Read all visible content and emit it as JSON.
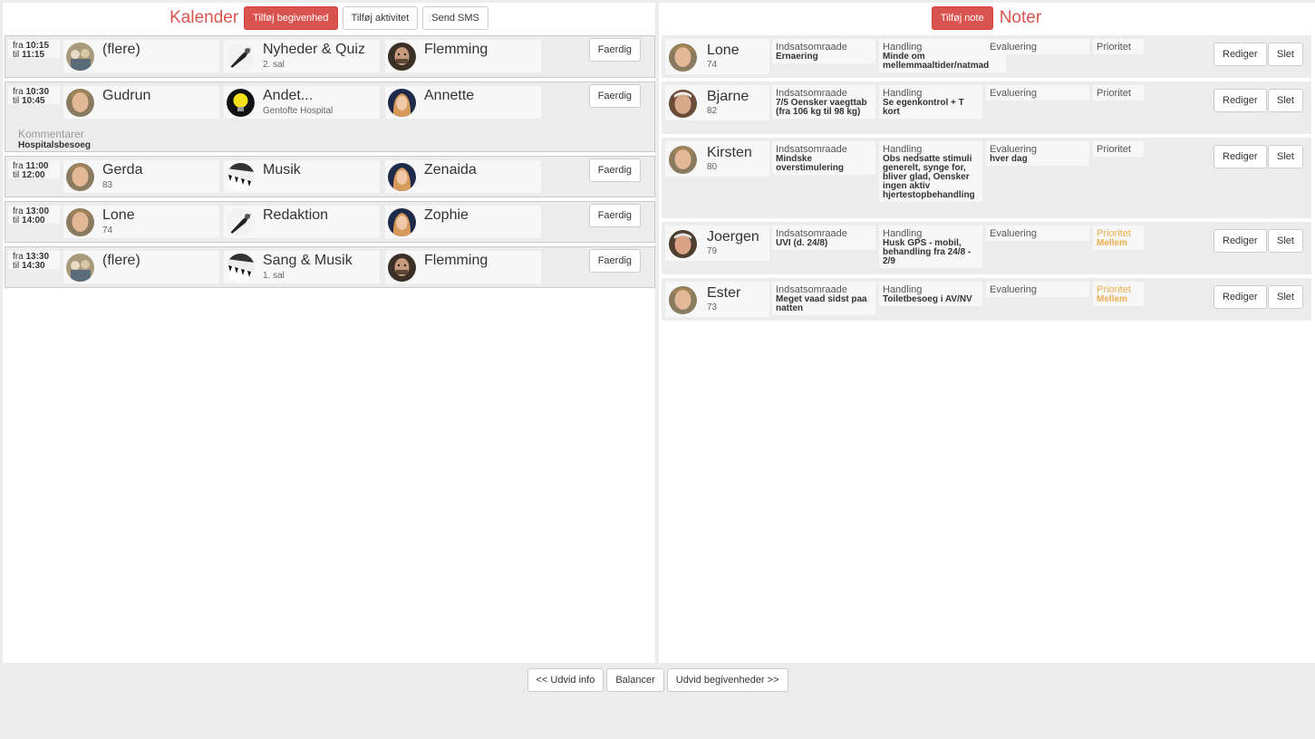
{
  "calendar": {
    "title": "Kalender",
    "buttons": {
      "add_event": "Tilføj begivenhed",
      "add_activity": "Tilføj aktivitet",
      "send_sms": "Send SMS"
    },
    "done_label": "Faerdig",
    "events": [
      {
        "from_prefix": "fra",
        "from": "10:15",
        "to_prefix": "til",
        "to": "11:15",
        "person": "(flere)",
        "person_sub": "",
        "activity": "Nyheder & Quiz",
        "activity_sub": "2. sal",
        "staff": "Flemming"
      },
      {
        "from_prefix": "fra",
        "from": "10:30",
        "to_prefix": "til",
        "to": "10:45",
        "person": "Gudrun",
        "person_sub": "",
        "activity": "Andet...",
        "activity_sub": "Gentofte Hospital",
        "staff": "Annette",
        "comment_label": "Kommentarer",
        "comment": "Hospitalsbesoeg"
      },
      {
        "from_prefix": "fra",
        "from": "11:00",
        "to_prefix": "til",
        "to": "12:00",
        "person": "Gerda",
        "person_sub": "83",
        "activity": "Musik",
        "activity_sub": "",
        "staff": "Zenaida"
      },
      {
        "from_prefix": "fra",
        "from": "13:00",
        "to_prefix": "til",
        "to": "14:00",
        "person": "Lone",
        "person_sub": "74",
        "activity": "Redaktion",
        "activity_sub": "",
        "staff": "Zophie"
      },
      {
        "from_prefix": "fra",
        "from": "13:30",
        "to_prefix": "til",
        "to": "14:30",
        "person": "(flere)",
        "person_sub": "",
        "activity": "Sang & Musik",
        "activity_sub": "1. sal",
        "staff": "Flemming"
      }
    ]
  },
  "notes": {
    "title": "Noter",
    "add_note": "Tilføj note",
    "edit_label": "Rediger",
    "delete_label": "Slet",
    "labels": {
      "area": "Indsatsomraade",
      "action": "Handling",
      "evaluation": "Evaluering",
      "priority": "Prioritet"
    },
    "items": [
      {
        "name": "Lone",
        "age": "74",
        "area": "Ernaering",
        "action": "Minde om mellemmaaltider/natmad",
        "evaluation": "",
        "priority": ""
      },
      {
        "name": "Bjarne",
        "age": "82",
        "area": "7/5 Oensker vaegttab (fra 106 kg til 98 kg)",
        "action": "Se egenkontrol + T kort",
        "evaluation": "",
        "priority": ""
      },
      {
        "name": "Kirsten",
        "age": "80",
        "area": "Mindske overstimulering",
        "action": "Obs nedsatte stimuli generelt, synge for, bliver glad, Oensker ingen aktiv hjertestopbehandling",
        "evaluation": "hver dag",
        "priority": ""
      },
      {
        "name": "Joergen",
        "age": "79",
        "area": "UVI (d. 24/8)",
        "action": "Husk GPS - mobil, behandling fra 24/8 - 2/9",
        "evaluation": "",
        "priority": "Mellem"
      },
      {
        "name": "Ester",
        "age": "73",
        "area": "Meget vaad sidst paa natten",
        "action": "Toiletbesoeg i AV/NV",
        "evaluation": "",
        "priority": "Mellem"
      }
    ]
  },
  "footer": {
    "expand_info": "<< Udvid info",
    "balance": "Balancer",
    "expand_events": "Udvid begivenheder >>"
  },
  "colors": {
    "accent": "#d9534f",
    "priority_mid": "#f0ad4e"
  }
}
